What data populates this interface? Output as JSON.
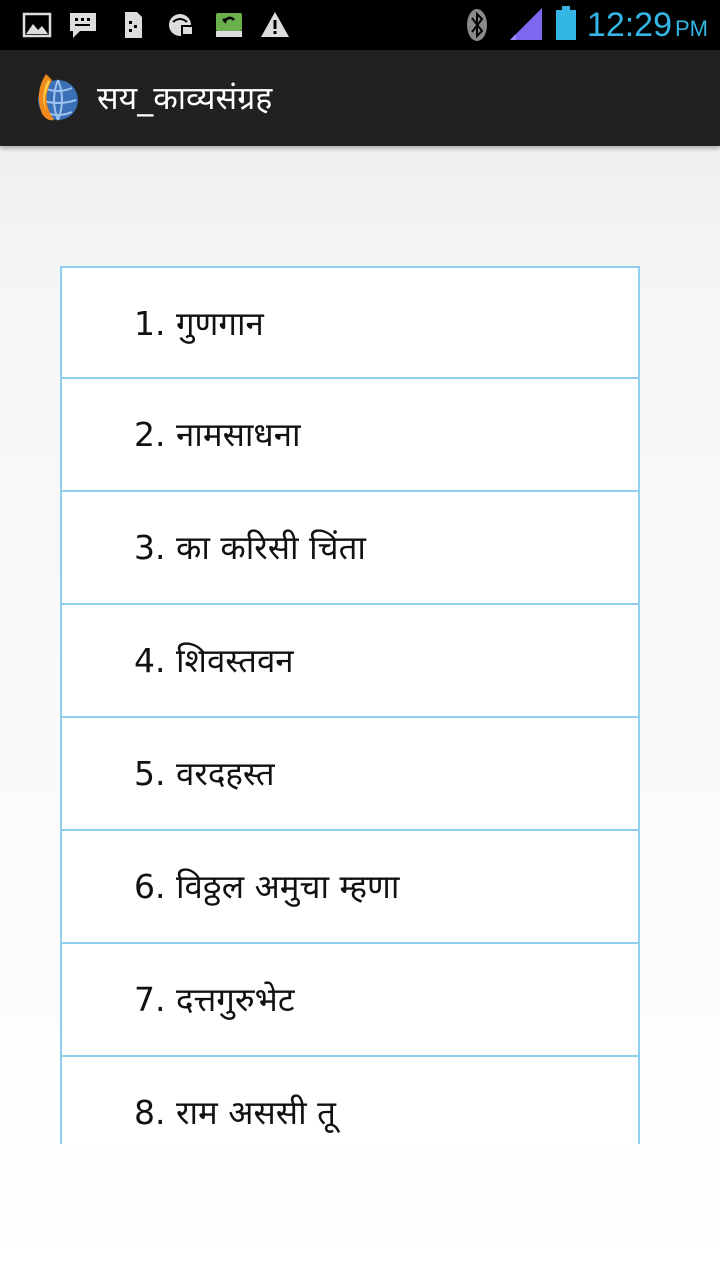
{
  "status_bar": {
    "time": "12:29",
    "ampm": "PM",
    "icons_left": [
      "image-icon",
      "message-icon",
      "sim-card-icon",
      "web-sync-icon",
      "download-icon",
      "warning-icon"
    ],
    "icons_right": [
      "bluetooth-icon",
      "signal-icon",
      "battery-icon"
    ],
    "accent": "#33b5e5"
  },
  "action_bar": {
    "title": "सय_काव्यसंग्रह",
    "app_icon": "app-logo-icon"
  },
  "list": {
    "items": [
      {
        "label": "1. गुणगान"
      },
      {
        "label": "2. नामसाधना"
      },
      {
        "label": "3. का करिसी चिंता"
      },
      {
        "label": "4. शिवस्तवन"
      },
      {
        "label": "5. वरदहस्त"
      },
      {
        "label": "6. विठ्ठल अमुचा म्हणा"
      },
      {
        "label": "7. दत्तगुरुभेट"
      },
      {
        "label": "8. राम अससी तू"
      }
    ],
    "border_color": "#8fd0ee"
  }
}
